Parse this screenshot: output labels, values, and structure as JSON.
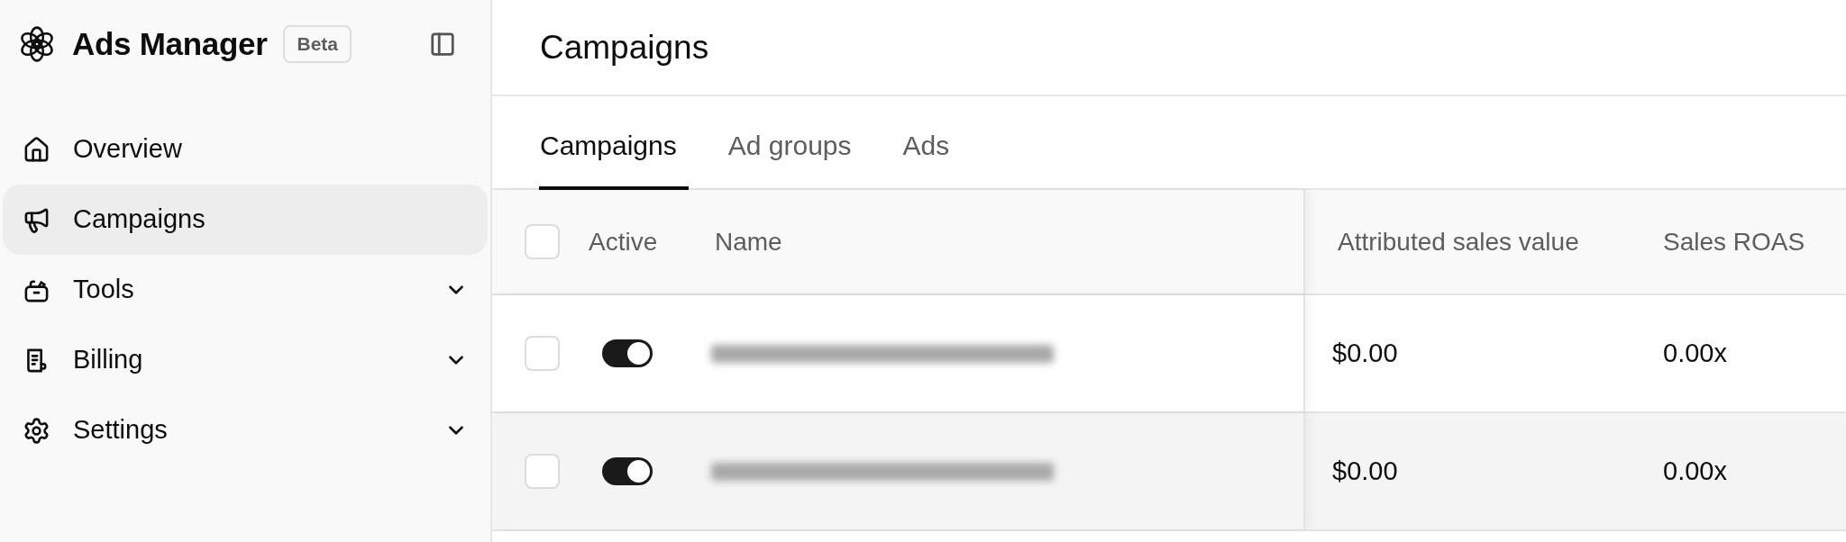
{
  "sidebar": {
    "title": "Ads Manager",
    "badge": "Beta",
    "nav_items": [
      {
        "label": "Overview",
        "selected": false
      },
      {
        "label": "Campaigns",
        "selected": true
      },
      {
        "label": "Tools",
        "selected": false,
        "expanded": false
      },
      {
        "label": "Billing",
        "selected": false,
        "expanded": false
      },
      {
        "label": "Settings",
        "selected": false,
        "expanded": false
      }
    ]
  },
  "main": {
    "title": "Campaigns",
    "tabs": [
      {
        "label": "Campaigns",
        "selected": true
      },
      {
        "label": "Ad groups",
        "selected": false
      },
      {
        "label": "Ads",
        "selected": false
      }
    ],
    "table": {
      "select_all": {
        "checked": false
      },
      "columns": [
        {
          "label": "Active"
        },
        {
          "label": "Name"
        },
        {
          "label": "Attributed sales value"
        },
        {
          "label": "Sales ROAS"
        }
      ],
      "rows": [
        {
          "checked": false,
          "active": true,
          "sales_value": "$0.00",
          "sales_roas": "0.00x"
        },
        {
          "checked": false,
          "active": true,
          "sales_value": "$0.00",
          "sales_roas": "0.00x"
        }
      ]
    }
  }
}
